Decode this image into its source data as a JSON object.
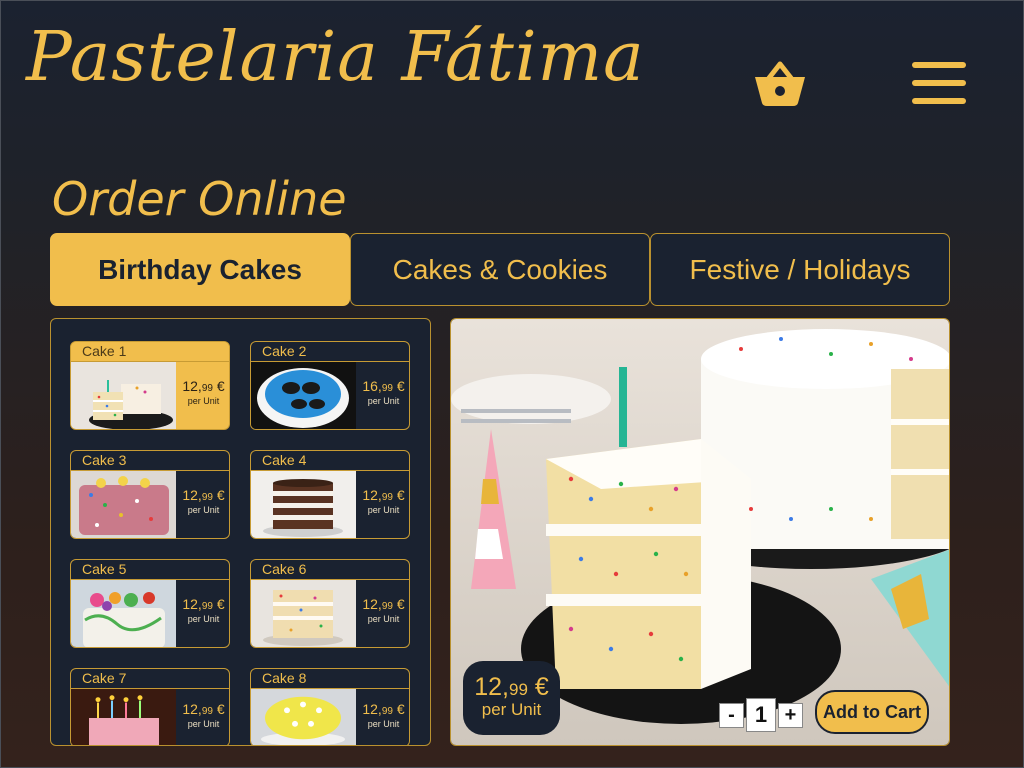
{
  "brand": {
    "name": "Pastelaria Fátima"
  },
  "header": {
    "cart_icon": "basket-icon",
    "menu_icon": "hamburger-icon"
  },
  "section_title": "Order Online",
  "tabs": [
    {
      "label": "Birthday Cakes",
      "active": true
    },
    {
      "label": "Cakes & Cookies",
      "active": false
    },
    {
      "label": "Festive / Holidays",
      "active": false
    }
  ],
  "products": [
    {
      "name": "Cake 1",
      "price_main": "12,",
      "price_cents": "99",
      "currency": "€",
      "unit": "per Unit",
      "active": true
    },
    {
      "name": "Cake 2",
      "price_main": "16,",
      "price_cents": "99",
      "currency": "€",
      "unit": "per Unit",
      "active": false
    },
    {
      "name": "Cake 3",
      "price_main": "12,",
      "price_cents": "99",
      "currency": "€",
      "unit": "per Unit",
      "active": false
    },
    {
      "name": "Cake 4",
      "price_main": "12,",
      "price_cents": "99",
      "currency": "€",
      "unit": "per Unit",
      "active": false
    },
    {
      "name": "Cake 5",
      "price_main": "12,",
      "price_cents": "99",
      "currency": "€",
      "unit": "per Unit",
      "active": false
    },
    {
      "name": "Cake 6",
      "price_main": "12,",
      "price_cents": "99",
      "currency": "€",
      "unit": "per Unit",
      "active": false
    },
    {
      "name": "Cake 7",
      "price_main": "12,",
      "price_cents": "99",
      "currency": "€",
      "unit": "per Unit",
      "active": false
    },
    {
      "name": "Cake 8",
      "price_main": "12,",
      "price_cents": "99",
      "currency": "€",
      "unit": "per Unit",
      "active": false
    }
  ],
  "selected": {
    "price_main": "12,",
    "price_cents": "99",
    "currency": "€",
    "unit": "per Unit",
    "quantity": "1",
    "minus": "-",
    "plus": "+",
    "add_to_cart": "Add to Cart"
  },
  "colors": {
    "accent": "#f1be4c",
    "panel": "#1a2230",
    "border": "#b9912f"
  }
}
